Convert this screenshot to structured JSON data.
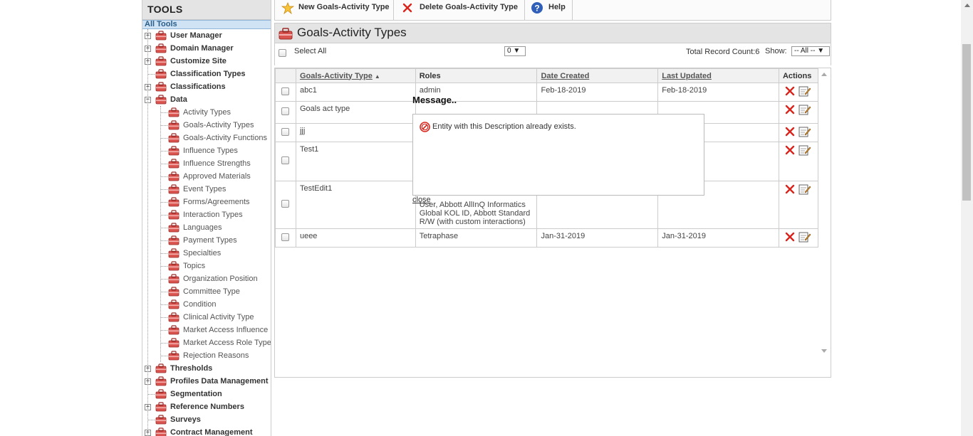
{
  "sidebar": {
    "header": "TOOLS",
    "all_tools": "All Tools",
    "items": [
      {
        "label": "User Manager",
        "level": 1,
        "expander": "+"
      },
      {
        "label": "Domain Manager",
        "level": 1,
        "expander": "+"
      },
      {
        "label": "Customize Site",
        "level": 1,
        "expander": "+"
      },
      {
        "label": "Classification Types",
        "level": 1,
        "expander": ""
      },
      {
        "label": "Classifications",
        "level": 1,
        "expander": "+"
      },
      {
        "label": "Data",
        "level": 1,
        "expander": "−"
      },
      {
        "label": "Activity Types",
        "level": 2
      },
      {
        "label": "Goals-Activity Types",
        "level": 2
      },
      {
        "label": "Goals-Activity Functions",
        "level": 2
      },
      {
        "label": "Influence Types",
        "level": 2
      },
      {
        "label": "Influence Strengths",
        "level": 2
      },
      {
        "label": "Approved Materials",
        "level": 2
      },
      {
        "label": "Event Types",
        "level": 2
      },
      {
        "label": "Forms/Agreements",
        "level": 2
      },
      {
        "label": "Interaction Types",
        "level": 2
      },
      {
        "label": "Languages",
        "level": 2
      },
      {
        "label": "Payment Types",
        "level": 2
      },
      {
        "label": "Specialties",
        "level": 2
      },
      {
        "label": "Topics",
        "level": 2
      },
      {
        "label": "Organization Position",
        "level": 2
      },
      {
        "label": "Committee Type",
        "level": 2
      },
      {
        "label": "Condition",
        "level": 2
      },
      {
        "label": "Clinical Activity Type",
        "level": 2
      },
      {
        "label": "Market Access Influence",
        "level": 2
      },
      {
        "label": "Market Access Role Type",
        "level": 2
      },
      {
        "label": "Rejection Reasons",
        "level": 2
      },
      {
        "label": "Thresholds",
        "level": 1,
        "expander": "+"
      },
      {
        "label": "Profiles Data Management",
        "level": 1,
        "expander": "+"
      },
      {
        "label": "Segmentation",
        "level": 1,
        "expander": ""
      },
      {
        "label": "Reference Numbers",
        "level": 1,
        "expander": "+"
      },
      {
        "label": "Surveys",
        "level": 1,
        "expander": ""
      },
      {
        "label": "Contract Management",
        "level": 1,
        "expander": "+"
      }
    ]
  },
  "toolbar": {
    "new_label": "New Goals-Activity Type",
    "delete_label": "Delete Goals-Activity Type",
    "help_label": "Help"
  },
  "page_title": "Goals-Activity Types",
  "selrow": {
    "select_all": "Select All",
    "page_select": "0 ▼",
    "record_count": "Total Record Count:6",
    "show_label": "Show:",
    "show_select": "-- All -- ▼"
  },
  "grid": {
    "headers": {
      "type": "Goals-Activity Type",
      "sort_arrow": "▲",
      "roles": "Roles",
      "created": "Date Created",
      "updated": "Last Updated",
      "actions": "Actions"
    },
    "rows": [
      {
        "type": "abc1",
        "roles": "admin",
        "created": "Feb-18-2019",
        "updated": "Feb-18-2019"
      },
      {
        "type": "Goals act type",
        "roles": "",
        "created": "",
        "updated": ""
      },
      {
        "type": "jjj",
        "roles": "",
        "created": "",
        "updated": ""
      },
      {
        "type": "Test1",
        "roles": "",
        "created": "",
        "updated": ""
      },
      {
        "type": "TestEdit1",
        "roles": "User, Abbott AllInQ Informatics Global KOL ID, Abbott Standard R/W (with custom interactions)",
        "created": "",
        "updated": ""
      },
      {
        "type": "ueee",
        "roles": "Tetraphase",
        "created": "Jan-31-2019",
        "updated": "Jan-31-2019"
      }
    ]
  },
  "popup": {
    "title": "Message..",
    "message": "Entity with this Description already exists.",
    "close": "close"
  },
  "colors": {
    "header_bg": "#e4e4e4",
    "all_tools_bg": "#cfe3f4",
    "delete_red": "#d9241c",
    "help_blue": "#2f5fb8"
  }
}
